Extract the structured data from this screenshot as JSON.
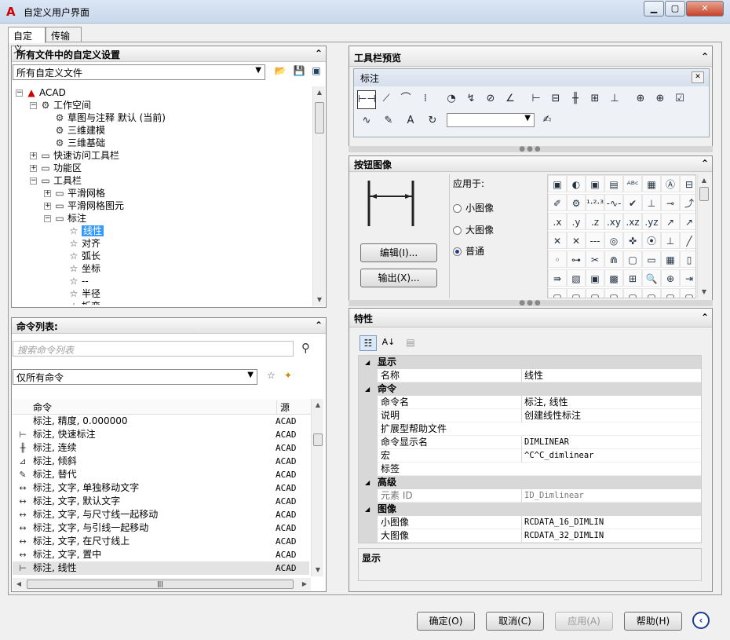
{
  "window": {
    "title": "自定义用户界面"
  },
  "tabs": [
    {
      "label": "自定义"
    },
    {
      "label": "传输"
    }
  ],
  "left_top": {
    "header": "所有文件中的自定义设置",
    "file_combo": "所有自定义文件",
    "tree": [
      {
        "label": "ACAD",
        "level": 0,
        "icon": "acad-icon",
        "exp": "-"
      },
      {
        "label": "工作空间",
        "level": 1,
        "icon": "workspace-icon",
        "exp": "-"
      },
      {
        "label": "草图与注释 默认 (当前)",
        "level": 2,
        "icon": "gear-icon",
        "exp": ""
      },
      {
        "label": "三维建模",
        "level": 2,
        "icon": "gear-icon",
        "exp": ""
      },
      {
        "label": "三维基础",
        "level": 2,
        "icon": "gear-icon",
        "exp": ""
      },
      {
        "label": "快速访问工具栏",
        "level": 1,
        "icon": "toolbar-icon",
        "exp": "+"
      },
      {
        "label": "功能区",
        "level": 1,
        "icon": "ribbon-icon",
        "exp": "+"
      },
      {
        "label": "工具栏",
        "level": 1,
        "icon": "toolbar-icon",
        "exp": "-"
      },
      {
        "label": "平滑网格",
        "level": 2,
        "icon": "toolbar-icon",
        "exp": "+"
      },
      {
        "label": "平滑网格图元",
        "level": 2,
        "icon": "toolbar-icon",
        "exp": "+"
      },
      {
        "label": "标注",
        "level": 2,
        "icon": "toolbar-icon",
        "exp": "-"
      },
      {
        "label": "线性",
        "level": 3,
        "icon": "star-icon",
        "exp": "",
        "selected": true
      },
      {
        "label": "对齐",
        "level": 3,
        "icon": "star-icon",
        "exp": ""
      },
      {
        "label": "弧长",
        "level": 3,
        "icon": "star-icon",
        "exp": ""
      },
      {
        "label": "坐标",
        "level": 3,
        "icon": "star-icon",
        "exp": ""
      },
      {
        "label": "--",
        "level": 3,
        "icon": "star-icon",
        "exp": ""
      },
      {
        "label": "半径",
        "level": 3,
        "icon": "star-icon",
        "exp": ""
      },
      {
        "label": "折弯",
        "level": 3,
        "icon": "star-icon",
        "exp": ""
      }
    ]
  },
  "left_bottom": {
    "header": "命令列表:",
    "search_placeholder": "搜索命令列表",
    "filter_combo": "仅所有命令",
    "columns": {
      "command": "命令",
      "source": "源"
    },
    "rows": [
      {
        "icon": "",
        "name": "标注, 精度, 0.000000",
        "src": "ACAD"
      },
      {
        "icon": "⊢",
        "name": "标注, 快速标注",
        "src": "ACAD"
      },
      {
        "icon": "╫",
        "name": "标注, 连续",
        "src": "ACAD"
      },
      {
        "icon": "⊿",
        "name": "标注, 倾斜",
        "src": "ACAD"
      },
      {
        "icon": "✎",
        "name": "标注, 替代",
        "src": "ACAD"
      },
      {
        "icon": "↔",
        "name": "标注, 文字, 单独移动文字",
        "src": "ACAD"
      },
      {
        "icon": "↔",
        "name": "标注, 文字, 默认文字",
        "src": "ACAD"
      },
      {
        "icon": "↔",
        "name": "标注, 文字, 与尺寸线一起移动",
        "src": "ACAD"
      },
      {
        "icon": "↔",
        "name": "标注, 文字, 与引线一起移动",
        "src": "ACAD"
      },
      {
        "icon": "↔",
        "name": "标注, 文字, 在尺寸线上",
        "src": "ACAD"
      },
      {
        "icon": "↔",
        "name": "标注, 文字, 置中",
        "src": "ACAD"
      },
      {
        "icon": "⊢",
        "name": "标注, 线性",
        "src": "ACAD",
        "highlight": true
      }
    ]
  },
  "toolbar_preview": {
    "header": "工具栏预览",
    "toolbar_title": "标注",
    "row1_icons": [
      "linear-dim-icon",
      "aligned-dim-icon",
      "arc-length-icon",
      "ordinate-icon",
      "radius-icon",
      "jogged-icon",
      "diameter-icon",
      "angular-icon",
      "quick-dim-icon",
      "baseline-icon",
      "continue-icon",
      "dim-space-icon",
      "dim-break-icon",
      "tolerance-icon",
      "center-mark-icon",
      "inspect-icon"
    ],
    "row2_icons": [
      "jogged-linear-icon",
      "dim-edit-icon",
      "dim-text-edit-icon",
      "dim-update-icon"
    ],
    "style_combo": "",
    "override_icon": "dim-override-icon"
  },
  "button_image": {
    "header": "按钮图像",
    "apply_label": "应用于:",
    "options": [
      {
        "label": "小图像",
        "checked": false
      },
      {
        "label": "大图像",
        "checked": false
      },
      {
        "label": "普通",
        "checked": true
      }
    ],
    "edit_button": "编辑(I)...",
    "export_button": "输出(X)...",
    "grid": [
      [
        "▣",
        "◐",
        "▣",
        "▤",
        "ᴬᴮᶜ",
        "▦",
        "Ⓐ",
        "⊟"
      ],
      [
        "✐",
        "⚙",
        "¹·²·³",
        "-∿-",
        "✔",
        "⊥",
        "⊸",
        "⤴"
      ],
      [
        ".x",
        ".y",
        ".z",
        ".xy",
        ".xz",
        ".yz",
        "↗",
        "↗"
      ],
      [
        "✕",
        "✕",
        "---",
        "◎",
        "✜",
        "⦿",
        "⊥",
        "╱"
      ],
      [
        "◦",
        "⊶",
        "✂",
        "⋒",
        "▢",
        "▭",
        "▦",
        "▯"
      ],
      [
        "⇛",
        "▧",
        "▣",
        "▩",
        "⊞",
        "🔍",
        "⊕",
        "⇥"
      ],
      [
        "▢",
        "▢",
        "▢",
        "▢",
        "▢",
        "▢",
        "▢",
        "▢"
      ]
    ]
  },
  "properties": {
    "header": "特性",
    "categories": [
      {
        "name": "显示",
        "rows": [
          {
            "k": "名称",
            "v": "线性",
            "mono": false
          }
        ]
      },
      {
        "name": "命令",
        "rows": [
          {
            "k": "命令名",
            "v": "标注, 线性",
            "mono": false
          },
          {
            "k": "说明",
            "v": "创建线性标注",
            "mono": false
          },
          {
            "k": "扩展型帮助文件",
            "v": "",
            "mono": false
          },
          {
            "k": "命令显示名",
            "v": "DIMLINEAR",
            "mono": true
          },
          {
            "k": "宏",
            "v": "^C^C_dimlinear",
            "mono": true
          },
          {
            "k": "标签",
            "v": "",
            "mono": false
          }
        ]
      },
      {
        "name": "高级",
        "rows": [
          {
            "k": "元素 ID",
            "v": "ID_Dimlinear",
            "mono": true,
            "gray": true
          }
        ]
      },
      {
        "name": "图像",
        "rows": [
          {
            "k": "小图像",
            "v": "RCDATA_16_DIMLIN",
            "mono": true
          },
          {
            "k": "大图像",
            "v": "RCDATA_32_DIMLIN",
            "mono": true
          }
        ]
      }
    ],
    "description_title": "显示"
  },
  "footer": {
    "ok": "确定(O)",
    "cancel": "取消(C)",
    "apply": "应用(A)",
    "help": "帮助(H)"
  }
}
